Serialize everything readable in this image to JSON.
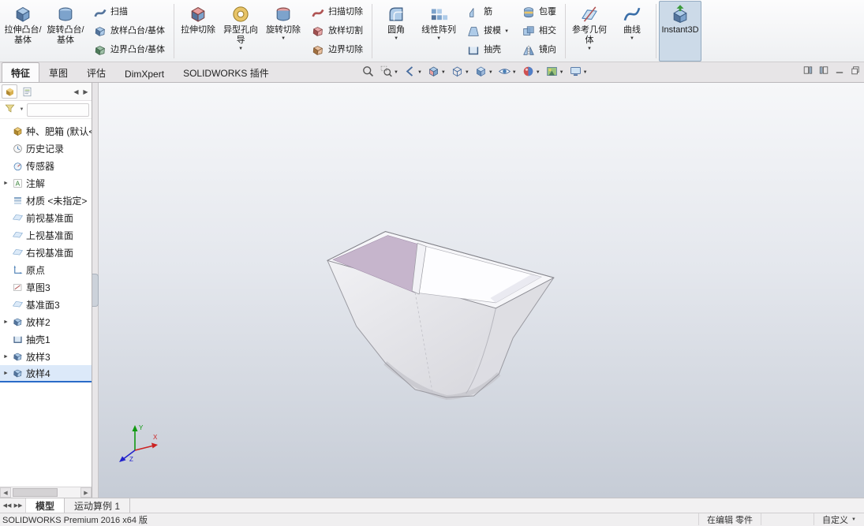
{
  "ribbon": {
    "columns": [
      {
        "kind": "big",
        "name": "extruded-boss-base",
        "icon": "extruded-boss",
        "label": "拉伸凸台/基体"
      },
      {
        "kind": "big",
        "name": "revolved-boss-base",
        "icon": "revolved-boss",
        "label": "旋转凸台/基体"
      },
      {
        "kind": "stack",
        "items": [
          {
            "name": "swept-boss-base",
            "icon": "swept-boss",
            "label": "扫描"
          },
          {
            "name": "lofted-boss-base",
            "icon": "lofted-boss",
            "label": "放样凸台/基体"
          },
          {
            "name": "boundary-boss-base",
            "icon": "boundary-boss",
            "label": "边界凸台/基体"
          }
        ]
      },
      {
        "kind": "sep"
      },
      {
        "kind": "big",
        "name": "extruded-cut",
        "icon": "extruded-cut",
        "label": "拉伸切除"
      },
      {
        "kind": "big",
        "name": "hole-wizard",
        "icon": "hole-wizard",
        "label": "异型孔向导",
        "arrow": true
      },
      {
        "kind": "big",
        "name": "revolved-cut",
        "icon": "revolved-cut",
        "label": "旋转切除",
        "arrow": true
      },
      {
        "kind": "stack",
        "items": [
          {
            "name": "swept-cut",
            "icon": "swept-cut",
            "label": "扫描切除"
          },
          {
            "name": "lofted-cut",
            "icon": "lofted-cut",
            "label": "放样切割"
          },
          {
            "name": "boundary-cut",
            "icon": "boundary-cut",
            "label": "边界切除"
          }
        ]
      },
      {
        "kind": "sep"
      },
      {
        "kind": "big",
        "name": "fillet",
        "icon": "fillet",
        "label": "圆角",
        "arrow": true
      },
      {
        "kind": "big",
        "name": "linear-pattern",
        "icon": "linear-pattern",
        "label": "线性阵列",
        "arrow": true
      },
      {
        "kind": "stack",
        "items": [
          {
            "name": "rib",
            "icon": "rib",
            "label": "筋"
          },
          {
            "name": "draft",
            "icon": "draft",
            "label": "拔模",
            "arrow": true
          },
          {
            "name": "shell",
            "icon": "shell",
            "label": "抽壳"
          }
        ]
      },
      {
        "kind": "stack",
        "items": [
          {
            "name": "wrap",
            "icon": "wrap",
            "label": "包覆"
          },
          {
            "name": "intersect",
            "icon": "intersect",
            "label": "相交"
          },
          {
            "name": "mirror",
            "icon": "mirror",
            "label": "镜向"
          }
        ]
      },
      {
        "kind": "sep"
      },
      {
        "kind": "big",
        "name": "reference-geometry",
        "icon": "reference-geometry",
        "label": "参考几何体",
        "arrow": true
      },
      {
        "kind": "big",
        "name": "curves",
        "icon": "curves",
        "label": "曲线",
        "arrow": true
      },
      {
        "kind": "sep"
      },
      {
        "kind": "big",
        "name": "instant3d",
        "icon": "instant3d",
        "label": "Instant3D",
        "active": true
      }
    ]
  },
  "command_tabs": [
    {
      "label": "特征",
      "active": true
    },
    {
      "label": "草图",
      "active": false
    },
    {
      "label": "评估",
      "active": false
    },
    {
      "label": "DimXpert",
      "active": false
    },
    {
      "label": "SOLIDWORKS 插件",
      "active": false
    }
  ],
  "viewport_toolbar": {
    "buttons": [
      {
        "name": "zoom-to-fit",
        "arrow": false
      },
      {
        "name": "zoom-to-area",
        "arrow": true
      },
      {
        "name": "previous-view",
        "arrow": true
      },
      {
        "name": "section-view",
        "arrow": true
      },
      {
        "name": "view-orientation",
        "arrow": true
      },
      {
        "name": "display-style",
        "arrow": true
      },
      {
        "name": "hide-show-items",
        "arrow": true
      },
      {
        "name": "edit-appearance",
        "arrow": true
      },
      {
        "name": "apply-scene",
        "arrow": true
      },
      {
        "name": "view-settings",
        "arrow": true
      }
    ]
  },
  "window_controls": [
    "previous-pane",
    "next-pane",
    "minimize",
    "restore"
  ],
  "feature_tree": {
    "items": [
      {
        "label": "种、肥箱 (默认<<",
        "icon": "part",
        "expand": false,
        "selected": false
      },
      {
        "label": "历史记录",
        "icon": "history",
        "expand": false,
        "selected": false
      },
      {
        "label": "传感器",
        "icon": "sensors",
        "expand": false,
        "selected": false
      },
      {
        "label": "注解",
        "icon": "annotations",
        "expand": true,
        "selected": false
      },
      {
        "label": "材质 <未指定>",
        "icon": "material",
        "expand": false,
        "selected": false
      },
      {
        "label": "前视基准面",
        "icon": "plane",
        "expand": false,
        "selected": false
      },
      {
        "label": "上视基准面",
        "icon": "plane",
        "expand": false,
        "selected": false
      },
      {
        "label": "右视基准面",
        "icon": "plane",
        "expand": false,
        "selected": false
      },
      {
        "label": "原点",
        "icon": "origin",
        "expand": false,
        "selected": false
      },
      {
        "label": "草图3",
        "icon": "sketch",
        "expand": false,
        "selected": false
      },
      {
        "label": "基准面3",
        "icon": "plane",
        "expand": false,
        "selected": false
      },
      {
        "label": "放样2",
        "icon": "loft",
        "expand": true,
        "selected": false
      },
      {
        "label": "抽壳1",
        "icon": "shell",
        "expand": false,
        "selected": false
      },
      {
        "label": "放样3",
        "icon": "loft",
        "expand": true,
        "selected": false
      },
      {
        "label": "放样4",
        "icon": "loft",
        "expand": true,
        "selected": true
      }
    ]
  },
  "bottom_tabs": [
    {
      "label": "模型",
      "active": true
    },
    {
      "label": "运动算例 1",
      "active": false
    }
  ],
  "status": {
    "product": "SOLIDWORKS Premium 2016 x64 版",
    "editing": "在编辑 零件",
    "customize": "自定义"
  },
  "colors": {
    "accent_blue": "#2a6bc8",
    "selection_bg": "#dce9f9",
    "inner_wall_purple": "#c6b5cc",
    "triad_x": "#cc2222",
    "triad_y": "#119911",
    "triad_z": "#2222cc"
  }
}
